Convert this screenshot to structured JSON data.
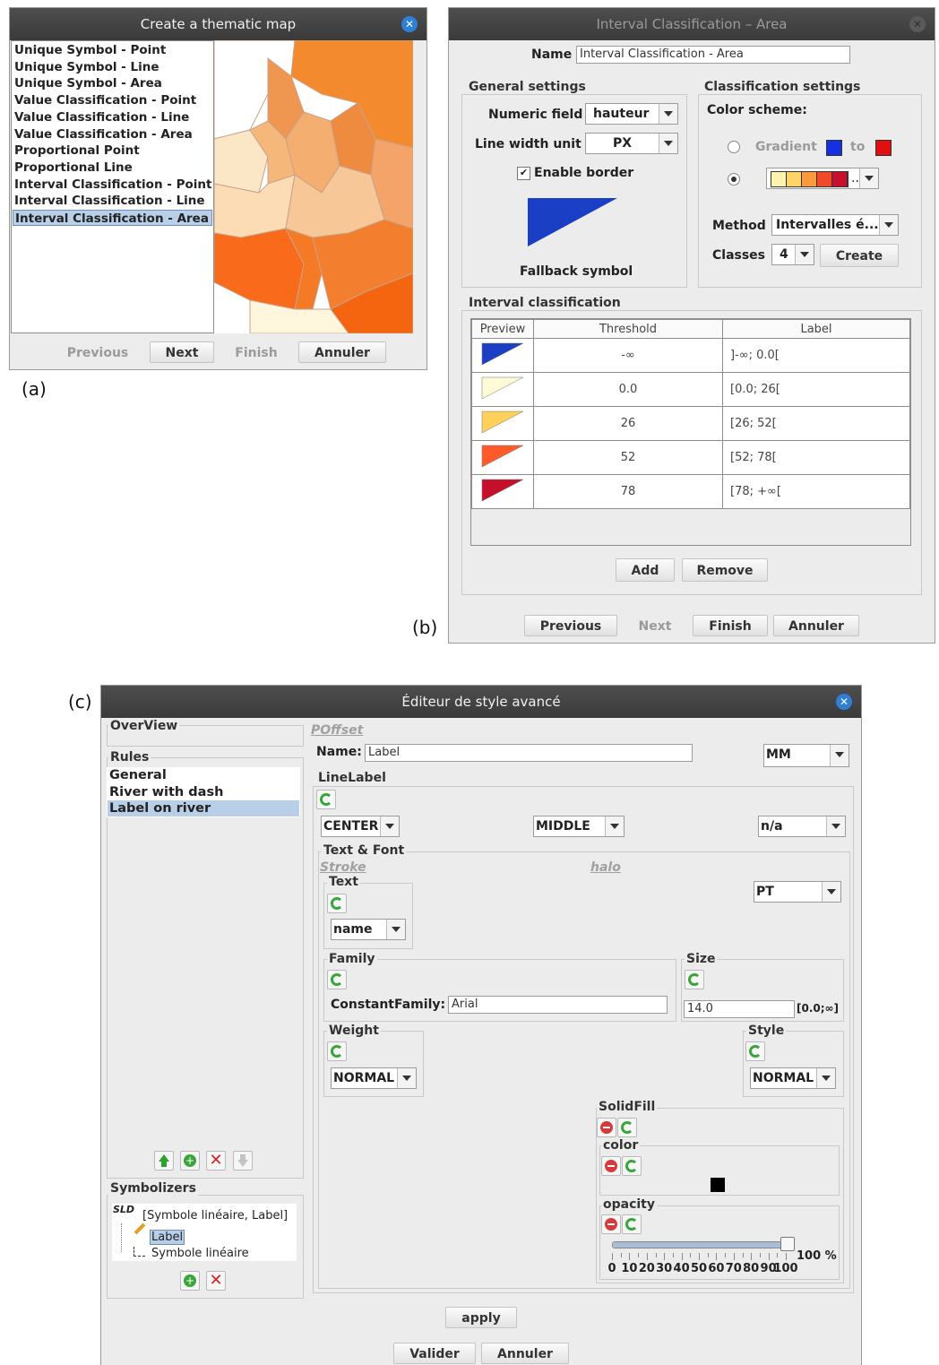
{
  "captions": {
    "a": "(a)",
    "b": "(b)",
    "c": "(c)"
  },
  "win_a": {
    "title": "Create a thematic map",
    "items": [
      "Unique Symbol - Point",
      "Unique Symbol - Line",
      "Unique Symbol - Area",
      "Value Classification - Point",
      "Value Classification - Line",
      "Value Classification - Area",
      "Proportional Point",
      "Proportional Line",
      "Interval Classification - Point",
      "Interval Classification - Line",
      "Interval Classification - Area"
    ],
    "selected_index": 10,
    "buttons": {
      "previous": "Previous",
      "next": "Next",
      "finish": "Finish",
      "cancel": "Annuler"
    }
  },
  "win_b": {
    "title": "Interval Classification – Area",
    "name_label": "Name",
    "name_value": "Interval Classification - Area",
    "general": {
      "title": "General settings",
      "numeric_field_label": "Numeric field",
      "numeric_field_value": "hauteur",
      "line_width_label": "Line width unit",
      "line_width_value": "PX",
      "enable_border_label": "Enable border",
      "enable_border_checked": true,
      "fallback_label": "Fallback symbol",
      "fallback_color": "#1a3fc4"
    },
    "classification": {
      "title": "Classification settings",
      "scheme_label": "Color scheme:",
      "gradient_label": "Gradient",
      "gradient_to": "to",
      "gradient_from_color": "#1430e0",
      "gradient_to_color": "#e01010",
      "palette": [
        "#fff3b0",
        "#ffd36a",
        "#ff9a3c",
        "#f04a2a",
        "#c8102e"
      ],
      "palette_more": "..",
      "method_label": "Method",
      "method_value": "Intervalles é...",
      "classes_label": "Classes",
      "classes_value": "4",
      "create_label": "Create"
    },
    "interval": {
      "title": "Interval classification",
      "headers": [
        "Preview",
        "Threshold",
        "Label"
      ],
      "rows": [
        {
          "color": "#1a3fc4",
          "threshold": "-∞",
          "label": "]-∞; 0.0["
        },
        {
          "color": "#fffbd6",
          "threshold": "0.0",
          "label": "[0.0; 26["
        },
        {
          "color": "#ffd05a",
          "threshold": "26",
          "label": "[26; 52["
        },
        {
          "color": "#ff5a2a",
          "threshold": "52",
          "label": "[52; 78["
        },
        {
          "color": "#c4102a",
          "threshold": "78",
          "label": "[78; +∞["
        }
      ],
      "add_label": "Add",
      "remove_label": "Remove"
    },
    "buttons": {
      "previous": "Previous",
      "next": "Next",
      "finish": "Finish",
      "cancel": "Annuler"
    }
  },
  "win_c": {
    "title": "Éditeur de style avancé",
    "overview_label": "OverView",
    "rules_label": "Rules",
    "rules": [
      "General",
      "River with dash",
      "Label on river"
    ],
    "selected_rule": 2,
    "symbolizers_label": "Symbolizers",
    "sld_icon_text": "SLD",
    "tree": [
      "[Symbole linéaire, Label]",
      "Label",
      "Symbole linéaire"
    ],
    "poffset": "POffset",
    "name_label": "Name:",
    "name_value": "Label",
    "unit_value": "MM",
    "linelabel_label": "LineLabel",
    "anchor_h": "CENTER",
    "anchor_v": "MIDDLE",
    "na_value": "n/a",
    "text_font_label": "Text & Font",
    "stroke_label": "Stroke",
    "halo_label": "halo",
    "text_label": "Text",
    "text_value": "name",
    "pt_value": "PT",
    "family_label": "Family",
    "constant_family_label": "ConstantFamily:",
    "constant_family_value": "Arial",
    "size_label": "Size",
    "size_value": "14.0",
    "size_range": "[0.0;∞]",
    "weight_label": "Weight",
    "weight_value": "NORMAL",
    "style_label": "Style",
    "style_value": "NORMAL",
    "solidfill_label": "SolidFill",
    "color_label": "color",
    "color_value": "#000000",
    "opacity_label": "opacity",
    "opacity_percent": 100,
    "opacity_text": "100 %",
    "slider_ticks": [
      "0",
      "10",
      "20",
      "30",
      "40",
      "50",
      "60",
      "70",
      "80",
      "90",
      "100"
    ],
    "apply_label": "apply",
    "validate_label": "Valider",
    "cancel_label": "Annuler"
  }
}
